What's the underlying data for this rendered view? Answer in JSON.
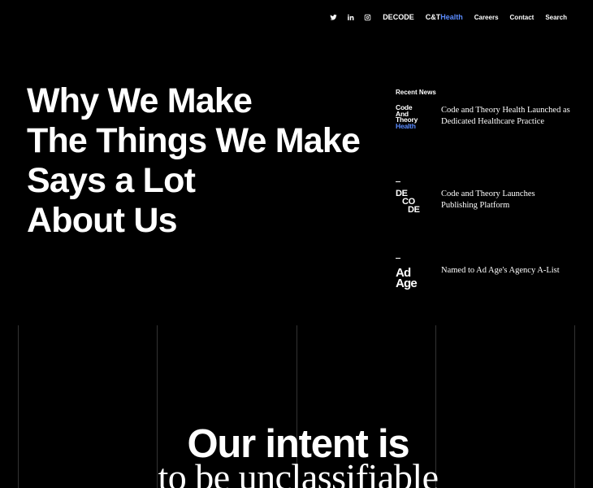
{
  "nav": {
    "social": [
      {
        "name": "twitter-icon"
      },
      {
        "name": "linkedin-icon"
      },
      {
        "name": "instagram-icon"
      }
    ],
    "decode": "DECODE",
    "ct_prefix": "C&T",
    "ct_health": "Health",
    "careers": "Careers",
    "contact": "Contact",
    "search": "Search",
    "health_color": "#5a8bff"
  },
  "hero": {
    "lines": [
      "Why We Make",
      "The Things We Make",
      "Says a Lot",
      "About Us"
    ]
  },
  "news": {
    "title": "Recent News",
    "items": [
      {
        "logo_lines": [
          "Code",
          "And",
          "Theory",
          "Health"
        ],
        "text": "Code and Theory Health Launched as Dedicated Healthcare Practice"
      },
      {
        "logo_lines": [
          "DE",
          "CO",
          "DE"
        ],
        "text": "Code and Theory Launches Publishing Platform"
      },
      {
        "logo_lines": [
          "Ad",
          "Age"
        ],
        "text": "Named to Ad Age's Agency A-List"
      }
    ]
  },
  "intent": {
    "line1": "Our intent is",
    "line2": "to be unclassifiable"
  }
}
